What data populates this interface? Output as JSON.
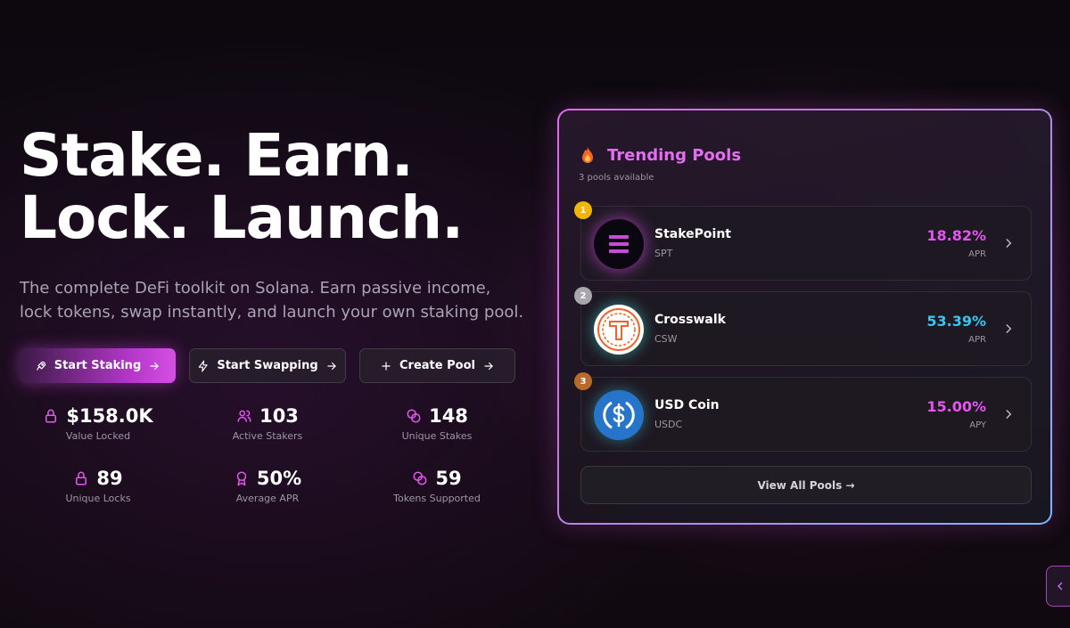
{
  "hero": {
    "title_line1": "Stake. Earn.",
    "title_line2": "Lock. Launch.",
    "subtitle": "The complete DeFi toolkit on Solana. Earn passive income, lock tokens, swap instantly, and launch your own staking pool."
  },
  "actions": {
    "start_staking": "Start Staking",
    "start_swapping": "Start Swapping",
    "create_pool": "Create Pool"
  },
  "stats": [
    {
      "value": "$158.0K",
      "label": "Value Locked",
      "icon": "lock-icon"
    },
    {
      "value": "103",
      "label": "Active Stakers",
      "icon": "users-icon"
    },
    {
      "value": "148",
      "label": "Unique Stakes",
      "icon": "coins-icon"
    },
    {
      "value": "89",
      "label": "Unique Locks",
      "icon": "lock-icon"
    },
    {
      "value": "50%",
      "label": "Average APR",
      "icon": "award-icon"
    },
    {
      "value": "59",
      "label": "Tokens Supported",
      "icon": "coins-icon"
    }
  ],
  "trending": {
    "title": "Trending Pools",
    "subtitle": "3 pools available",
    "icon": "flame-icon",
    "pools": [
      {
        "rank": "1",
        "name": "StakePoint",
        "symbol": "SPT",
        "rate": "18.82%",
        "rate_label": "APR",
        "rate_color": "#e356f0",
        "rank_color": "#f2b705"
      },
      {
        "rank": "2",
        "name": "Crosswalk",
        "symbol": "CSW",
        "rate": "53.39%",
        "rate_label": "APR",
        "rate_color": "#34c8f0",
        "rank_color": "#a7a7ad"
      },
      {
        "rank": "3",
        "name": "USD Coin",
        "symbol": "USDC",
        "rate": "15.00%",
        "rate_label": "APY",
        "rate_color": "#e356f0",
        "rank_color": "#b8692c"
      }
    ],
    "view_all": "View All Pools →"
  },
  "colors": {
    "accent": "#d54fe3",
    "background": "#120a13"
  }
}
